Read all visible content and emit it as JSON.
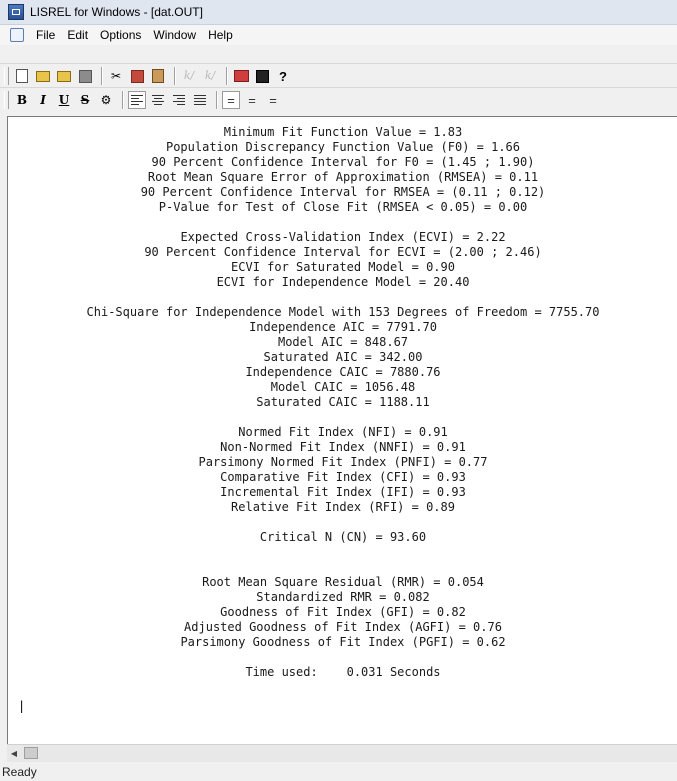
{
  "window": {
    "title": "LISREL for Windows - [dat.OUT]"
  },
  "menu": {
    "items": [
      "File",
      "Edit",
      "Options",
      "Window",
      "Help"
    ]
  },
  "toolbar_icons": [
    "new-document-icon",
    "open-folder-icon",
    "open-folder-alt-icon",
    "save-icon",
    "cut-icon",
    "copy-icon",
    "paste-icon",
    "path-diagram-icon",
    "path-diagram-alt-icon",
    "print-icon",
    "black-box-icon",
    "help-icon"
  ],
  "format_toolbar": {
    "bold": "B",
    "italic": "I",
    "underline": "U",
    "strike": "S",
    "align_icons": [
      "align-left-icon",
      "align-center-icon",
      "align-right-icon",
      "justify-icon"
    ],
    "spacing_icons": [
      "single-space-icon",
      "one-half-space-icon",
      "double-space-icon"
    ]
  },
  "output_lines": [
    "Minimum Fit Function Value = 1.83",
    "Population Discrepancy Function Value (F0) = 1.66",
    "90 Percent Confidence Interval for F0 = (1.45 ; 1.90)",
    "Root Mean Square Error of Approximation (RMSEA) = 0.11",
    "90 Percent Confidence Interval for RMSEA = (0.11 ; 0.12)",
    "P-Value for Test of Close Fit (RMSEA < 0.05) = 0.00",
    "",
    "Expected Cross-Validation Index (ECVI) = 2.22",
    "90 Percent Confidence Interval for ECVI = (2.00 ; 2.46)",
    "ECVI for Saturated Model = 0.90",
    "ECVI for Independence Model = 20.40",
    "",
    "Chi-Square for Independence Model with 153 Degrees of Freedom = 7755.70",
    "Independence AIC = 7791.70",
    "Model AIC = 848.67",
    "Saturated AIC = 342.00",
    "Independence CAIC = 7880.76",
    "Model CAIC = 1056.48",
    "Saturated CAIC = 1188.11",
    "",
    "Normed Fit Index (NFI) = 0.91",
    "Non-Normed Fit Index (NNFI) = 0.91",
    "Parsimony Normed Fit Index (PNFI) = 0.77",
    "Comparative Fit Index (CFI) = 0.93",
    "Incremental Fit Index (IFI) = 0.93",
    "Relative Fit Index (RFI) = 0.89",
    "",
    "Critical N (CN) = 93.60",
    "",
    "",
    "Root Mean Square Residual (RMR) = 0.054",
    "Standardized RMR = 0.082",
    "Goodness of Fit Index (GFI) = 0.82",
    "Adjusted Goodness of Fit Index (AGFI) = 0.76",
    "Parsimony Goodness of Fit Index (PGFI) = 0.62",
    "",
    "Time used:    0.031 Seconds"
  ],
  "status": {
    "text": "Ready"
  }
}
